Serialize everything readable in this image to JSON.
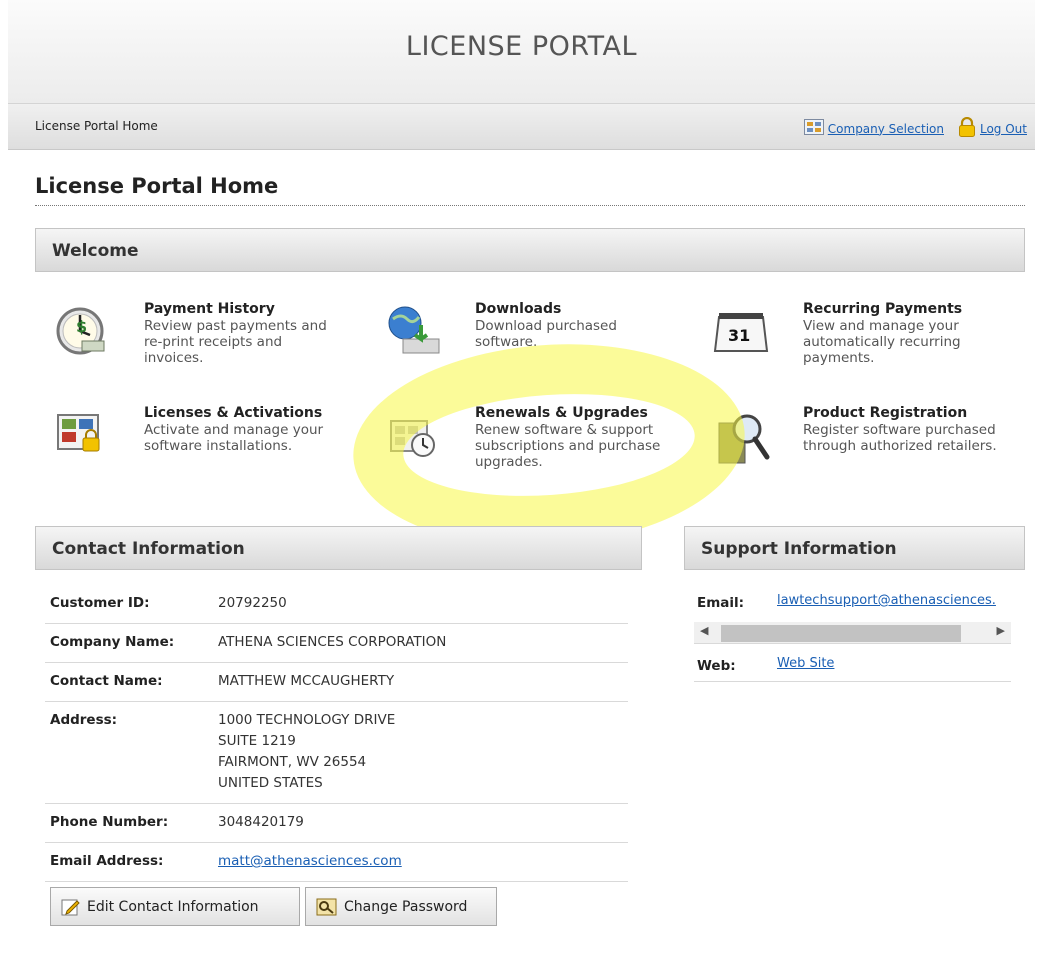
{
  "header": {
    "title": "LICENSE PORTAL"
  },
  "nav": {
    "breadcrumb": "License Portal Home",
    "company_selection": "Company Selection",
    "log_out": "Log Out"
  },
  "page": {
    "title": "License Portal Home"
  },
  "welcome": {
    "heading": "Welcome",
    "tiles": [
      {
        "title": "Payment History",
        "desc": "Review past payments and re-print receipts and invoices.",
        "icon": "payment-history-icon"
      },
      {
        "title": "Downloads",
        "desc": "Download purchased software.",
        "icon": "downloads-icon"
      },
      {
        "title": "Recurring Payments",
        "desc": "View and manage your automatically recurring payments.",
        "icon": "calendar-icon",
        "calendar_day": "31"
      },
      {
        "title": "Licenses & Activations",
        "desc": "Activate and manage your software installations.",
        "icon": "licenses-icon"
      },
      {
        "title": "Renewals & Upgrades",
        "desc": "Renew software & support subscriptions and purchase upgrades.",
        "icon": "renewals-icon"
      },
      {
        "title": "Product Registration",
        "desc": "Register software purchased through authorized retailers.",
        "icon": "magnifier-icon"
      }
    ]
  },
  "contact": {
    "heading": "Contact Information",
    "rows": [
      {
        "label": "Customer ID:",
        "value": "20792250"
      },
      {
        "label": "Company Name:",
        "value": "ATHENA SCIENCES CORPORATION"
      },
      {
        "label": "Contact Name:",
        "value": "MATTHEW MCCAUGHERTY"
      },
      {
        "label": "Address:",
        "lines": [
          "1000 TECHNOLOGY DRIVE",
          "SUITE 1219",
          "FAIRMONT, WV 26554",
          "UNITED STATES"
        ]
      },
      {
        "label": "Phone Number:",
        "value": "3048420179"
      },
      {
        "label": "Email Address:",
        "value": "matt@athenasciences.com"
      }
    ],
    "edit_button": "Edit Contact Information",
    "password_button": "Change Password"
  },
  "support": {
    "heading": "Support Information",
    "email_label": "Email:",
    "email": "lawtechsupport@athenasciences.",
    "web_label": "Web:",
    "web": "Web Site"
  },
  "colors": {
    "link": "#1a5fb4",
    "highlight": "#f8f846"
  }
}
